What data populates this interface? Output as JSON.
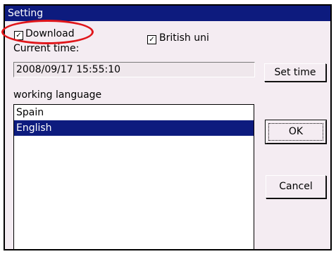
{
  "window": {
    "title": "Setting"
  },
  "options": {
    "download": {
      "label": "Download",
      "checked": true
    },
    "british": {
      "label": "British uni",
      "checked": true
    }
  },
  "current_time": {
    "label": "Current time:",
    "value": "2008/09/17 15:55:10"
  },
  "buttons": {
    "set_time": "Set time",
    "ok": "OK",
    "cancel": "Cancel"
  },
  "language": {
    "label": "working language",
    "items": [
      "Spain",
      "English"
    ],
    "selected": "English"
  },
  "colors": {
    "titlebar": "#0d1b7e",
    "highlight_ellipse": "#e0161b",
    "selection": "#0d1b7e"
  },
  "glyphs": {
    "checkmark": "✓"
  }
}
